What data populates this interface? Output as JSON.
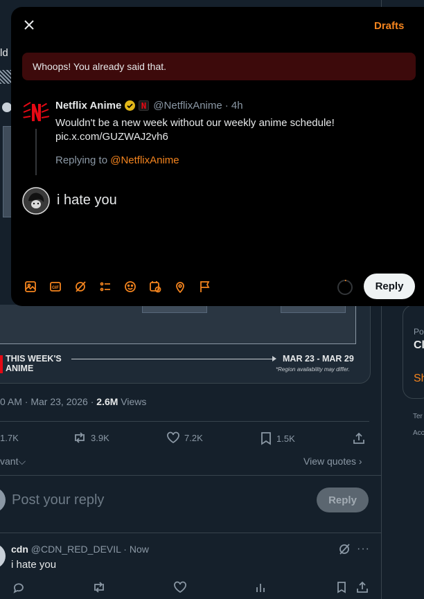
{
  "background": {
    "left_fragment_1": "ld",
    "banner": {
      "title_line1": "THIS WEEK'S",
      "title_line2": "ANIME",
      "date_range": "MAR 23 - MAR 29",
      "disclaimer": "*Region availability may differ."
    },
    "meta": {
      "time_date": "0 AM · Mar 23, 2026 · ",
      "views_count": "2.6M",
      "views_label": " Views"
    },
    "stats": {
      "replies": "1.7K",
      "reposts": "3.9K",
      "likes": "7.2K",
      "bookmarks": "1.5K"
    },
    "sort_label": "vant",
    "view_quotes": "View quotes",
    "composer": {
      "placeholder": "Post your reply",
      "reply_label": "Reply"
    },
    "reply": {
      "name": "cdn",
      "handle": "@CDN_RED_DEVIL",
      "time": "· Now",
      "text": "i hate you"
    },
    "right_panel": {
      "label_po": "Po",
      "label_cl": "Cl",
      "label_sh": "Sh",
      "footer_1": "Ter",
      "footer_2": "Acc"
    }
  },
  "modal": {
    "drafts_label": "Drafts",
    "alert_text": "Whoops! You already said that.",
    "quoted": {
      "name": "Netflix Anime",
      "handle": "@NetflixAnime",
      "time": "· 4h",
      "text_line1": "Wouldn't be a new week without our weekly anime schedule!",
      "text_line2": "pic.x.com/GUZWAJ2vh6",
      "replying_prefix": "Replying to ",
      "replying_handle": "@NetflixAnime"
    },
    "draft_text": "i hate you",
    "reply_label": "Reply",
    "toolbar_icons": [
      "image-icon",
      "gif-icon",
      "grok-icon",
      "poll-icon",
      "emoji-icon",
      "schedule-icon",
      "location-icon",
      "flag-icon"
    ]
  },
  "colors": {
    "accent": "#f4841e",
    "modal_bg": "#000000",
    "page_bg": "#15202b",
    "alert_bg": "#3d0a0b",
    "netflix_red": "#e50914",
    "verified_gold": "#e2b719"
  }
}
